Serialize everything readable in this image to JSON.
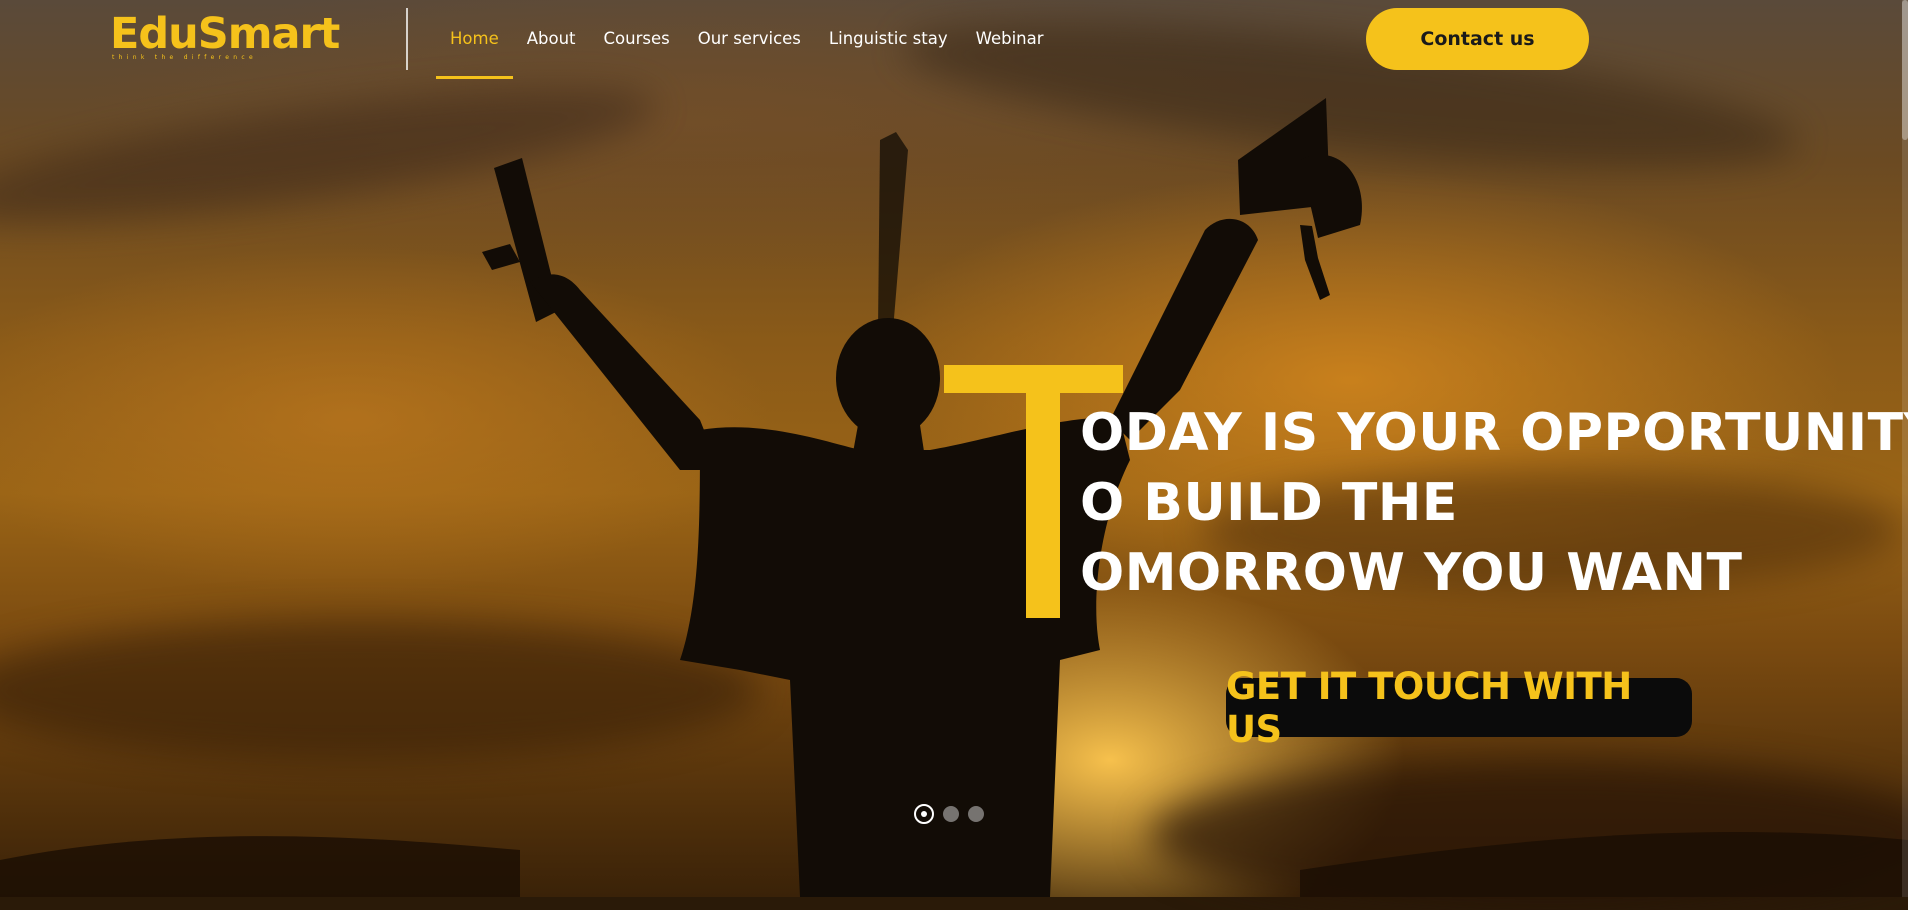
{
  "brand": {
    "logo_text": "EduSmart",
    "tagline": "think the difference",
    "accent_color": "#f5c21b"
  },
  "nav": {
    "items": [
      {
        "label": "Home",
        "active": true
      },
      {
        "label": "About",
        "active": false
      },
      {
        "label": "Courses",
        "active": false
      },
      {
        "label": "Our services",
        "active": false
      },
      {
        "label": "Linguistic stay",
        "active": false
      },
      {
        "label": "Webinar",
        "active": false
      }
    ]
  },
  "header": {
    "contact_label": "Contact us"
  },
  "hero": {
    "big_letter": "T",
    "lines": [
      "ODAY IS YOUR OPPORTUNITY",
      "O BUILD THE",
      "OMORROW YOU WANT"
    ],
    "cta_label": "GET IT TOUCH WITH US",
    "slides_total": 3,
    "active_slide": 1
  }
}
